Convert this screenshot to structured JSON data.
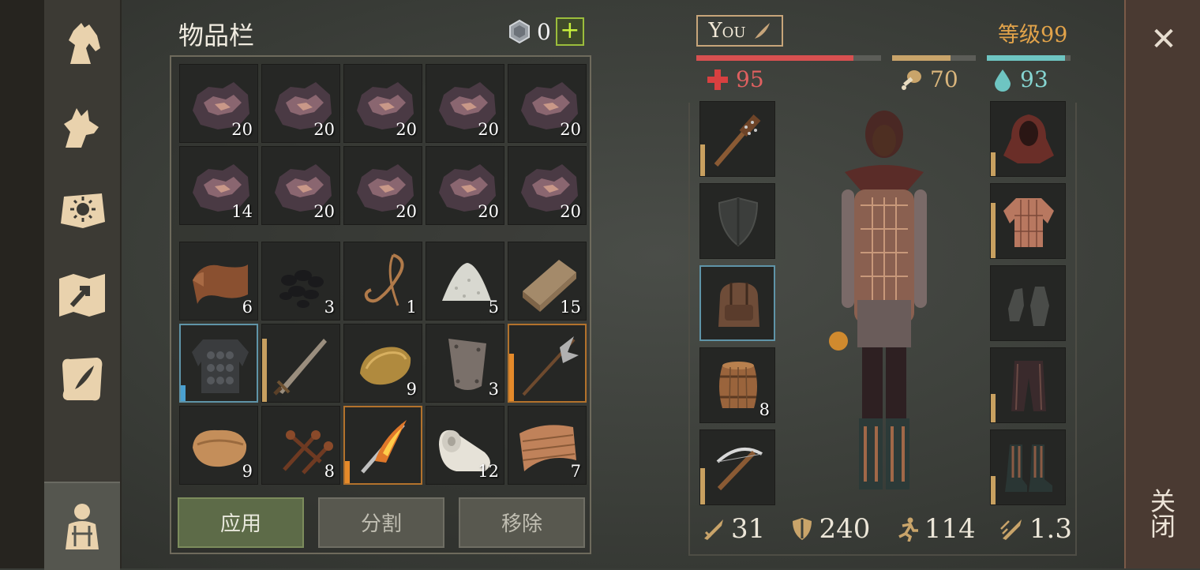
{
  "inventory": {
    "title": "物品栏",
    "currency_value": "0",
    "plus_label": "+",
    "rows": [
      [
        {
          "icon": "ore-icon",
          "count": "20"
        },
        {
          "icon": "ore-icon",
          "count": "20"
        },
        {
          "icon": "ore-icon",
          "count": "20"
        },
        {
          "icon": "ore-icon",
          "count": "20"
        },
        {
          "icon": "ore-icon",
          "count": "20"
        }
      ],
      [
        {
          "icon": "ore-icon",
          "count": "14"
        },
        {
          "icon": "ore-icon",
          "count": "20"
        },
        {
          "icon": "ore-icon",
          "count": "20"
        },
        {
          "icon": "ore-icon",
          "count": "20"
        },
        {
          "icon": "ore-icon",
          "count": "20"
        }
      ],
      [
        {
          "icon": "leather-icon",
          "count": "6"
        },
        {
          "icon": "coal-icon",
          "count": "3"
        },
        {
          "icon": "rope-icon",
          "count": "1"
        },
        {
          "icon": "salt-icon",
          "count": "5"
        },
        {
          "icon": "plank-icon",
          "count": "15"
        }
      ],
      [
        {
          "icon": "scale-armor-icon",
          "count": ""
        },
        {
          "icon": "sword-icon",
          "count": ""
        },
        {
          "icon": "ingot-icon",
          "count": "9"
        },
        {
          "icon": "metal-plate-icon",
          "count": "3"
        },
        {
          "icon": "halberd-icon",
          "count": ""
        }
      ],
      [
        {
          "icon": "cloth-icon",
          "count": "9"
        },
        {
          "icon": "nails-icon",
          "count": "8"
        },
        {
          "icon": "flame-sword-icon",
          "count": ""
        },
        {
          "icon": "linen-roll-icon",
          "count": "12"
        },
        {
          "icon": "fabric-icon",
          "count": "7"
        }
      ]
    ]
  },
  "buttons": {
    "apply": "应用",
    "split": "分割",
    "remove": "移除"
  },
  "character": {
    "name": "You",
    "level": "等级99",
    "health": "95",
    "food": "70",
    "water": "93",
    "health_fraction": 0.85,
    "food_fraction": 0.7,
    "water_fraction": 0.93,
    "left_slots": [
      {
        "icon": "spiked-club-icon",
        "count": ""
      },
      {
        "icon": "shield-icon",
        "count": ""
      },
      {
        "icon": "backpack-icon",
        "count": ""
      },
      {
        "icon": "barrel-icon",
        "count": "8"
      },
      {
        "icon": "crossbow-icon",
        "count": ""
      }
    ],
    "right_slots": [
      {
        "icon": "hood-icon"
      },
      {
        "icon": "chain-shirt-icon"
      },
      {
        "icon": "gloves-icon"
      },
      {
        "icon": "pants-icon"
      },
      {
        "icon": "boots-icon"
      }
    ],
    "attack": "31",
    "defense": "240",
    "speed": "114",
    "attack_speed": "1.3"
  },
  "close": {
    "x": "✕",
    "label": "关闭"
  },
  "colors": {
    "health": "#d85050",
    "food": "#c9a46a",
    "water": "#6ec5c2",
    "level": "#e2a34a",
    "accent_green": "#9bbd3c"
  }
}
